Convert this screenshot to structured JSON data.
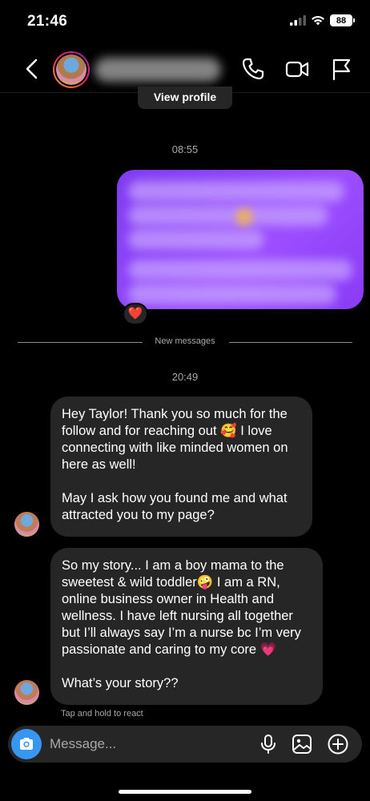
{
  "status_bar": {
    "time": "21:46",
    "battery": "88",
    "icons": [
      "signal-icon",
      "wifi-icon",
      "battery-icon"
    ]
  },
  "header": {
    "icons": [
      "back-chevron-icon",
      "phone-icon",
      "video-icon",
      "flag-icon"
    ]
  },
  "view_profile_label": "View profile",
  "timestamps": {
    "first": "08:55",
    "second": "20:49"
  },
  "sent_message": {
    "reaction": "❤️"
  },
  "new_messages_label": "New messages",
  "received_messages": [
    {
      "paragraphs": [
        "Hey Taylor! Thank you so much for the follow and for reaching out 🥰 I love connecting with like minded women on here as well!",
        "May I ask how you found me and what attracted you to my page?"
      ]
    },
    {
      "paragraphs": [
        "So my story... I am a boy mama to the sweetest & wild toddler🤪 I am a RN, online business owner in Health and wellness. I have left nursing all together but I’ll always say I’m a nurse bc I’m very passionate and caring to my core 💗",
        "What’s your story??"
      ]
    }
  ],
  "hint": "Tap and hold to react",
  "composer": {
    "placeholder": "Message...",
    "icons": [
      "camera-icon",
      "microphone-icon",
      "gallery-icon",
      "plus-circle-icon"
    ]
  },
  "colors": {
    "background": "#000000",
    "received_bubble": "#262626",
    "sent_bubble": "#8a3bf5",
    "accent": "#3797f0"
  }
}
